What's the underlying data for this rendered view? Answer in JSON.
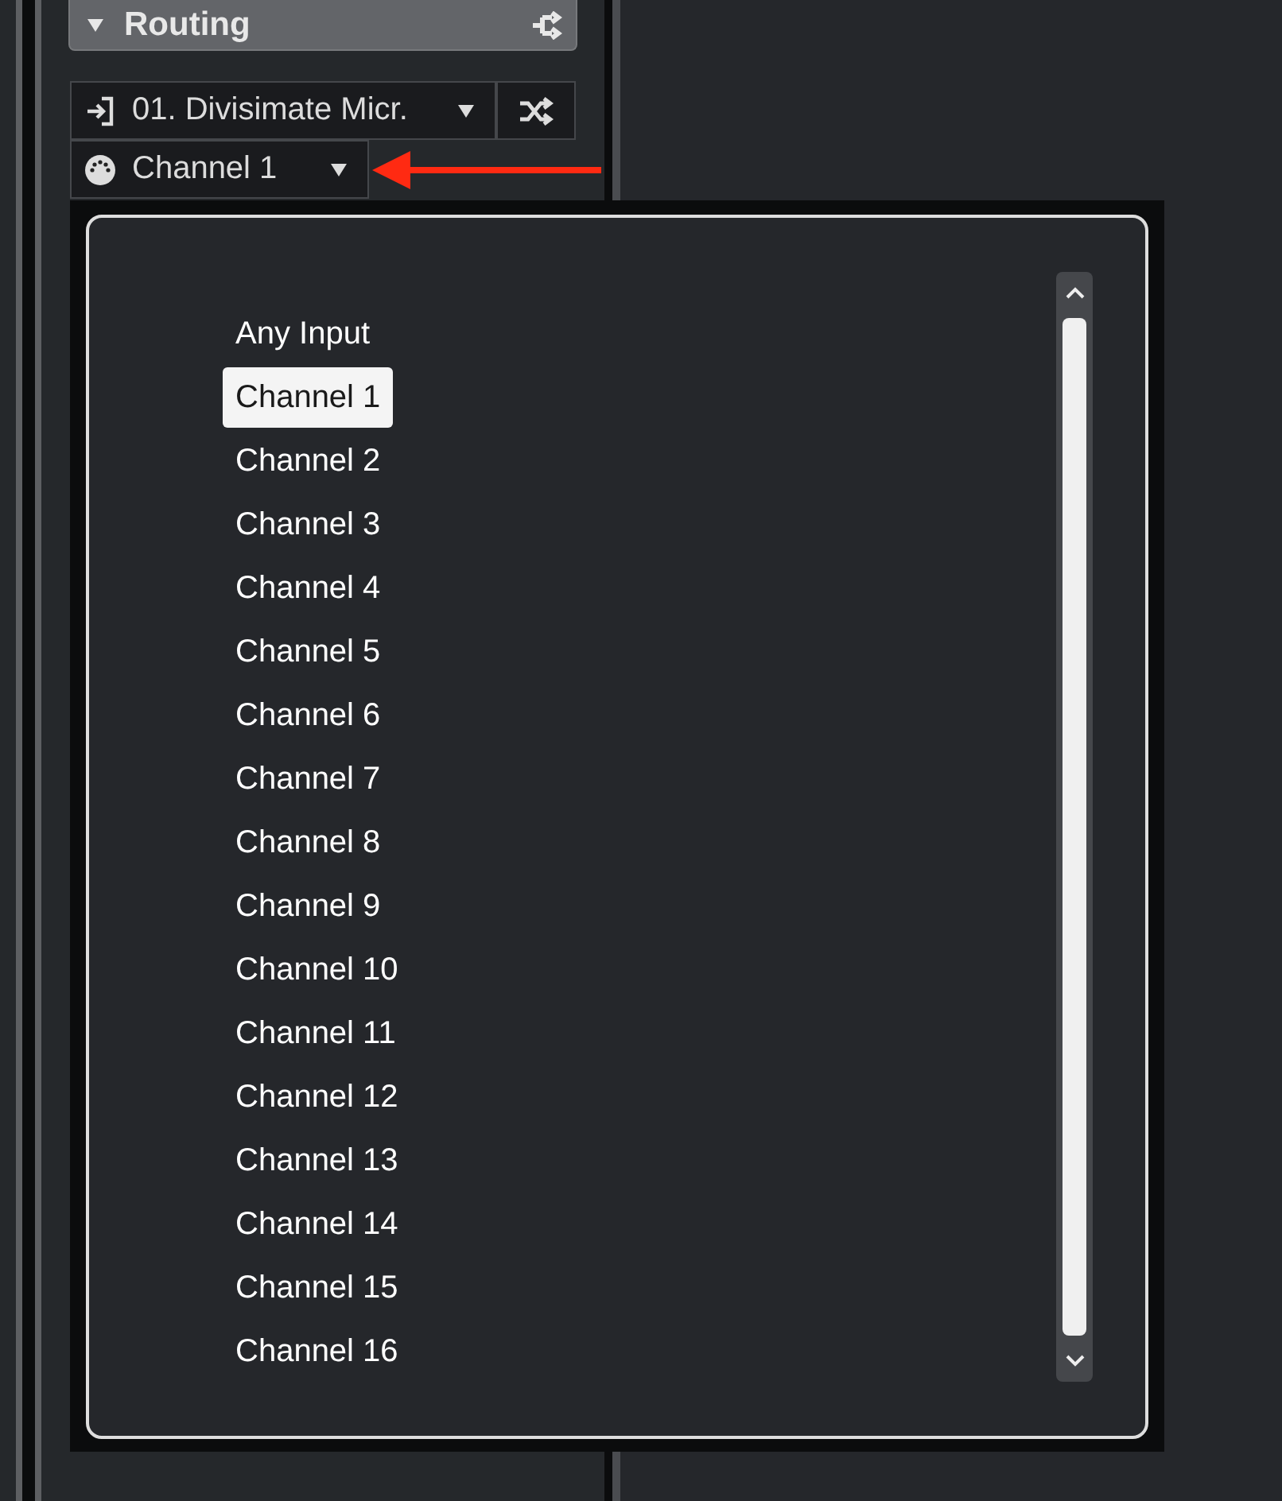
{
  "section": {
    "title": "Routing",
    "expanded": true
  },
  "input_routing": {
    "value": "01. Divisimate Micr."
  },
  "channel_select": {
    "value": "Channel 1"
  },
  "channel_menu": {
    "items": [
      {
        "label": "Any Input",
        "selected": false
      },
      {
        "label": "Channel 1",
        "selected": true
      },
      {
        "label": "Channel 2",
        "selected": false
      },
      {
        "label": "Channel 3",
        "selected": false
      },
      {
        "label": "Channel 4",
        "selected": false
      },
      {
        "label": "Channel 5",
        "selected": false
      },
      {
        "label": "Channel 6",
        "selected": false
      },
      {
        "label": "Channel 7",
        "selected": false
      },
      {
        "label": "Channel 8",
        "selected": false
      },
      {
        "label": "Channel 9",
        "selected": false
      },
      {
        "label": "Channel 10",
        "selected": false
      },
      {
        "label": "Channel 11",
        "selected": false
      },
      {
        "label": "Channel 12",
        "selected": false
      },
      {
        "label": "Channel 13",
        "selected": false
      },
      {
        "label": "Channel 14",
        "selected": false
      },
      {
        "label": "Channel 15",
        "selected": false
      },
      {
        "label": "Channel 16",
        "selected": false
      }
    ]
  }
}
